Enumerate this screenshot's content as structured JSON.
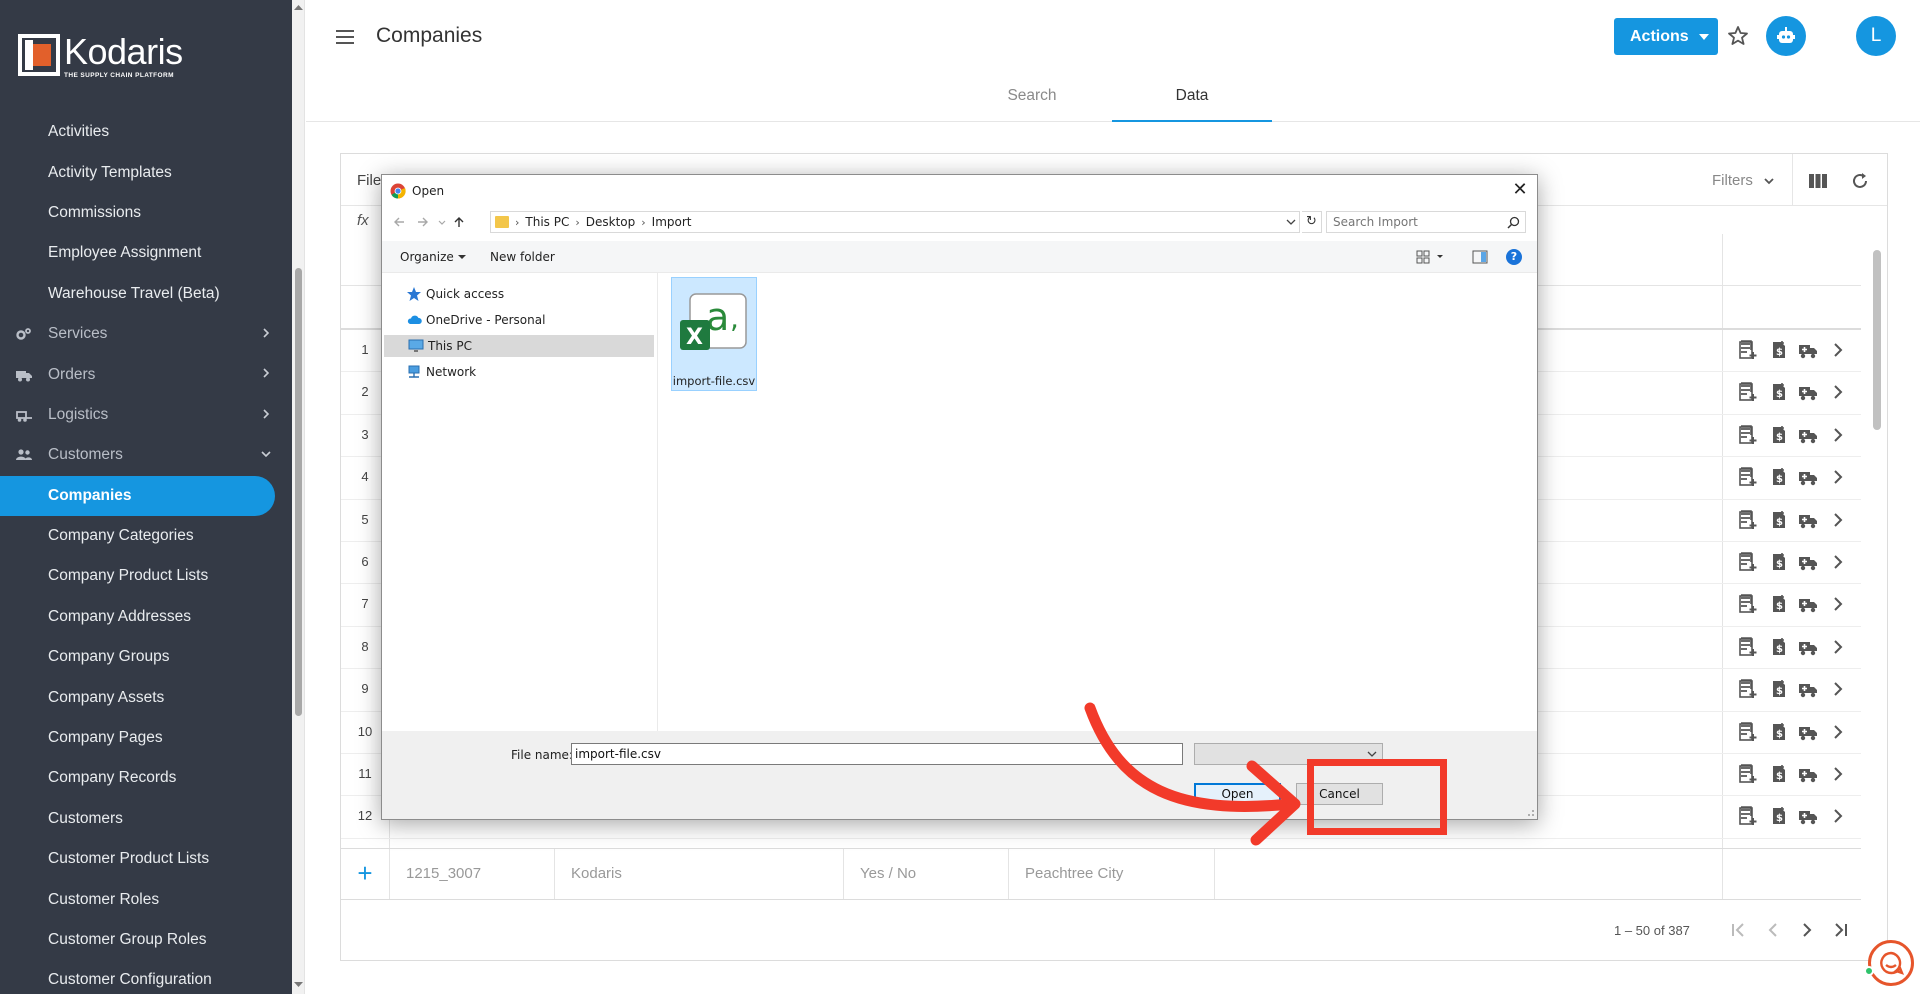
{
  "sidebar": {
    "logo": {
      "name": "Kodaris",
      "tagline": "THE SUPPLY CHAIN PLATFORM"
    },
    "items": [
      {
        "label": "Activities",
        "type": "item"
      },
      {
        "label": "Activity Templates",
        "type": "item"
      },
      {
        "label": "Commissions",
        "type": "item"
      },
      {
        "label": "Employee Assignment",
        "type": "item"
      },
      {
        "label": "Warehouse Travel (Beta)",
        "type": "item"
      },
      {
        "label": "Services",
        "type": "group",
        "icon": "gears-icon"
      },
      {
        "label": "Orders",
        "type": "group",
        "icon": "truck-icon"
      },
      {
        "label": "Logistics",
        "type": "group",
        "icon": "forklift-icon"
      },
      {
        "label": "Customers",
        "type": "group",
        "icon": "users-icon",
        "expanded": true
      },
      {
        "label": "Companies",
        "type": "item",
        "active": true
      },
      {
        "label": "Company Categories",
        "type": "item"
      },
      {
        "label": "Company Product Lists",
        "type": "item"
      },
      {
        "label": "Company Addresses",
        "type": "item"
      },
      {
        "label": "Company Groups",
        "type": "item"
      },
      {
        "label": "Company Assets",
        "type": "item"
      },
      {
        "label": "Company Pages",
        "type": "item"
      },
      {
        "label": "Company Records",
        "type": "item"
      },
      {
        "label": "Customers",
        "type": "item"
      },
      {
        "label": "Customer Product Lists",
        "type": "item"
      },
      {
        "label": "Customer Roles",
        "type": "item"
      },
      {
        "label": "Customer Group Roles",
        "type": "item"
      },
      {
        "label": "Customer Configuration",
        "type": "item"
      }
    ]
  },
  "header": {
    "title": "Companies",
    "actions_label": "Actions",
    "avatar_initial": "L",
    "tabs": [
      {
        "label": "Search",
        "active": false
      },
      {
        "label": "Data",
        "active": true
      }
    ]
  },
  "panel": {
    "file_label": "File",
    "filters_label": "Filters",
    "fx_label": "fx",
    "row_numbers": [
      "1",
      "2",
      "3",
      "4",
      "5",
      "6",
      "7",
      "8",
      "9",
      "10",
      "11",
      "12"
    ],
    "new_row": {
      "cells": [
        "1215_3007",
        "Kodaris",
        "Yes / No",
        "Peachtree City"
      ]
    },
    "pager_text": "1 – 50 of 387"
  },
  "dialog": {
    "title": "Open",
    "breadcrumb": [
      "This PC",
      "Desktop",
      "Import"
    ],
    "search_placeholder": "Search Import",
    "organize_label": "Organize",
    "new_folder_label": "New folder",
    "help_glyph": "?",
    "nav_items": [
      {
        "label": "Quick access",
        "icon": "star-icon"
      },
      {
        "label": "OneDrive - Personal",
        "icon": "cloud-icon"
      },
      {
        "label": "This PC",
        "icon": "monitor-icon",
        "selected": true
      },
      {
        "label": "Network",
        "icon": "network-icon"
      }
    ],
    "file": {
      "name": "import-file.csv"
    },
    "file_name_label": "File name:",
    "file_name_value": "import-file.csv",
    "open_label": "Open",
    "cancel_label": "Cancel"
  },
  "colors": {
    "accent": "#1596e0",
    "sidebar_bg": "#343a46",
    "annotation": "#f23a2a",
    "logo_orange": "#e2602b"
  }
}
